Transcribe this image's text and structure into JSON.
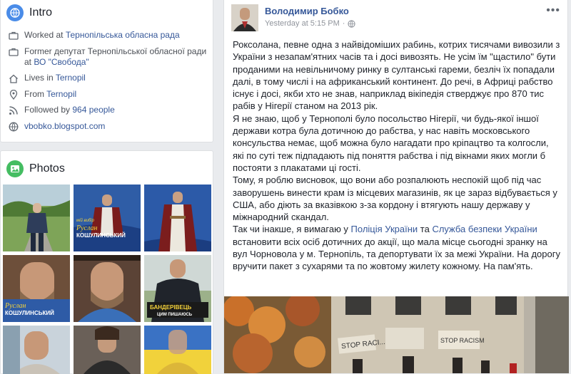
{
  "intro": {
    "title": "Intro",
    "rows": [
      {
        "icon": "briefcase-icon",
        "prefix": "Worked at ",
        "link": "Тернопільська обласна рада"
      },
      {
        "icon": "briefcase-icon",
        "prefix": "Former депутат Тернопільської обласної ради at ",
        "link": "ВО \"Свобода\""
      },
      {
        "icon": "home-icon",
        "prefix": "Lives in ",
        "link": "Ternopil"
      },
      {
        "icon": "location-pin-icon",
        "prefix": "From ",
        "link": "Ternopil"
      },
      {
        "icon": "followers-icon",
        "prefix": "Followed by ",
        "link": "964 people"
      },
      {
        "icon": "globe-icon",
        "prefix": "",
        "link": "vbobko.blogspot.com"
      }
    ]
  },
  "photos": {
    "title": "Photos",
    "tile_captions": {
      "banner1_top": "мій вибір",
      "banner1_name1": "Руслан",
      "banner1_name2": "КОШУЛИНСЬКИЙ",
      "banner2_line1": "БАНДЕРІВЕЦЬ",
      "banner2_line2": "ЦИМ ПИШАЮСЬ"
    }
  },
  "post": {
    "author": "Володимир Бобко",
    "timestamp": "Yesterday at 5:15 PM",
    "separator": "·",
    "menu_dots": "•••",
    "p1": "Роксолана, певне одна з найвідоміших рабинь, котрих тисячами вивозили з України з незапам'ятних часів та і досі вивозять. Не усім їм \"щастило\" бути проданими на невільничому ринку в султанські гареми, безліч їх попадали далі, в тому числі і на африканський континент. До речі, в Африці рабство існує і досі, якби хто не знав, наприклад вікіпедія стверджує про 870 тис рабів у Нігерії станом на 2013 рік.",
    "p2": "Я не знаю, щоб у Тернополі було посольство Нігерії, чи будь-якої іншої держави котра була дотичною до рабства, у нас навіть московського консульства немає, щоб можна було нагадати про кріпацтво та колгосли, які по суті теж підпадають під поняття рабства і під вікнами яких могли б постояти з плакатами ці гості.",
    "p3": "Тому, я роблю висновок, що вони або розпалюють неспокій щоб під час заворушень винести крам із місцевих магазинів, як це зараз відбувається у США, або діють за вказівкою з-за кордону і втягують нашу державу у міжнародний скандал.",
    "p4_a": "Так чи інакше, я вимагаю у ",
    "p4_link1": "Поліція України",
    "p4_b": " та ",
    "p4_link2": "Служба безпеки України",
    "p4_c": " встановити всіх осіб дотичних до акції, що мала місце сьогодні зранку на вул Чорновола у м. Тернопіль, та депортувати їх за межі України. На дорогу вручити пакет з сухарями та по жовтому жилету кожному. На пам'ять.",
    "image_sign1": "STOP RACI...",
    "image_sign2": "STOP RACISM"
  }
}
